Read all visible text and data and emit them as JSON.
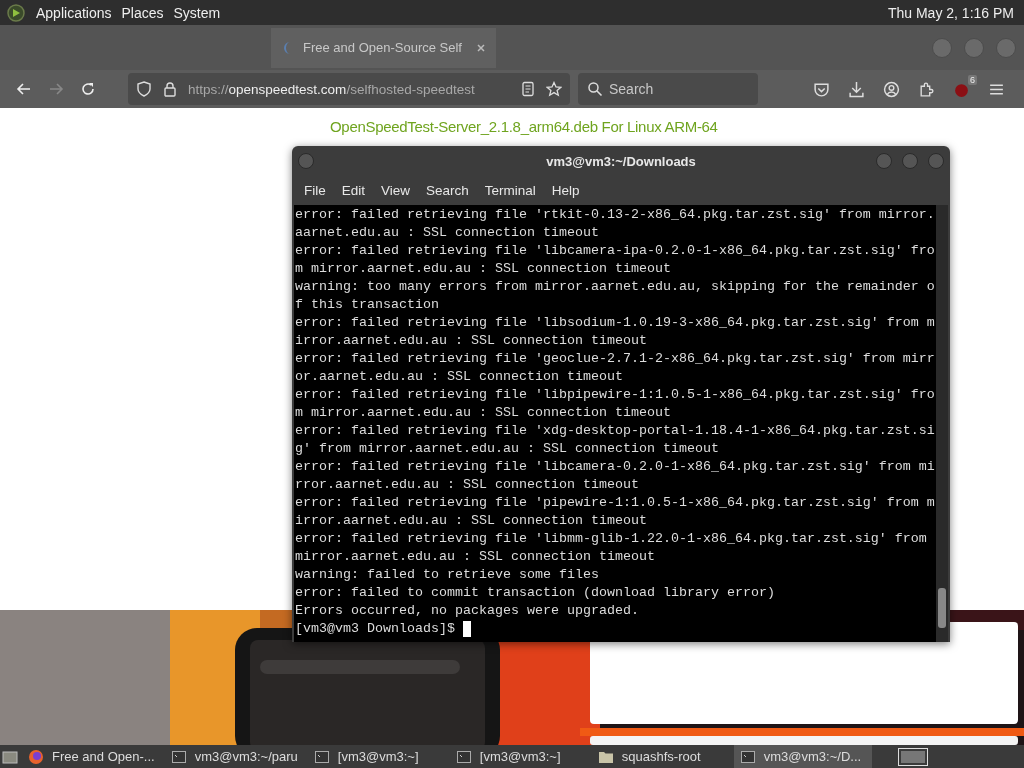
{
  "top_panel": {
    "menus": [
      "Applications",
      "Places",
      "System"
    ],
    "clock": "Thu May  2,  1:16 PM"
  },
  "browser": {
    "tabs": [
      {
        "title": "Free and Open-Source Self",
        "selected": true
      }
    ],
    "url": {
      "scheme": "https://",
      "host": "openspeedtest.com",
      "path": "/selfhosted-speedtest"
    },
    "search": {
      "placeholder": "Search"
    },
    "extension_badge": "6",
    "page": {
      "link": "OpenSpeedTest-Server_2.1.8_arm64.deb For Linux ARM-64"
    }
  },
  "terminal": {
    "title": "vm3@vm3:~/Downloads",
    "menus": [
      "File",
      "Edit",
      "View",
      "Search",
      "Terminal",
      "Help"
    ],
    "lines": [
      "error: failed retrieving file 'rtkit-0.13-2-x86_64.pkg.tar.zst.sig' from mirror.",
      "aarnet.edu.au : SSL connection timeout",
      "error: failed retrieving file 'libcamera-ipa-0.2.0-1-x86_64.pkg.tar.zst.sig' fro",
      "m mirror.aarnet.edu.au : SSL connection timeout",
      "warning: too many errors from mirror.aarnet.edu.au, skipping for the remainder o",
      "f this transaction",
      "error: failed retrieving file 'libsodium-1.0.19-3-x86_64.pkg.tar.zst.sig' from m",
      "irror.aarnet.edu.au : SSL connection timeout",
      "error: failed retrieving file 'geoclue-2.7.1-2-x86_64.pkg.tar.zst.sig' from mirr",
      "or.aarnet.edu.au : SSL connection timeout",
      "error: failed retrieving file 'libpipewire-1:1.0.5-1-x86_64.pkg.tar.zst.sig' fro",
      "m mirror.aarnet.edu.au : SSL connection timeout",
      "error: failed retrieving file 'xdg-desktop-portal-1.18.4-1-x86_64.pkg.tar.zst.si",
      "g' from mirror.aarnet.edu.au : SSL connection timeout",
      "error: failed retrieving file 'libcamera-0.2.0-1-x86_64.pkg.tar.zst.sig' from mi",
      "rror.aarnet.edu.au : SSL connection timeout",
      "error: failed retrieving file 'pipewire-1:1.0.5-1-x86_64.pkg.tar.zst.sig' from m",
      "irror.aarnet.edu.au : SSL connection timeout",
      "error: failed retrieving file 'libmm-glib-1.22.0-1-x86_64.pkg.tar.zst.sig' from",
      "mirror.aarnet.edu.au : SSL connection timeout",
      "warning: failed to retrieve some files",
      "error: failed to commit transaction (download library error)",
      "Errors occurred, no packages were upgraded."
    ],
    "prompt": "[vm3@vm3 Downloads]$"
  },
  "taskbar": [
    {
      "kind": "browser",
      "label": "Free and Open-...",
      "selected": false
    },
    {
      "kind": "terminal",
      "label": "vm3@vm3:~/paru",
      "selected": false
    },
    {
      "kind": "terminal",
      "label": "[vm3@vm3:~]",
      "selected": false
    },
    {
      "kind": "terminal",
      "label": "[vm3@vm3:~]",
      "selected": false
    },
    {
      "kind": "folder",
      "label": "squashfs-root",
      "selected": false
    },
    {
      "kind": "terminal",
      "label": "vm3@vm3:~/D...",
      "selected": true
    }
  ]
}
